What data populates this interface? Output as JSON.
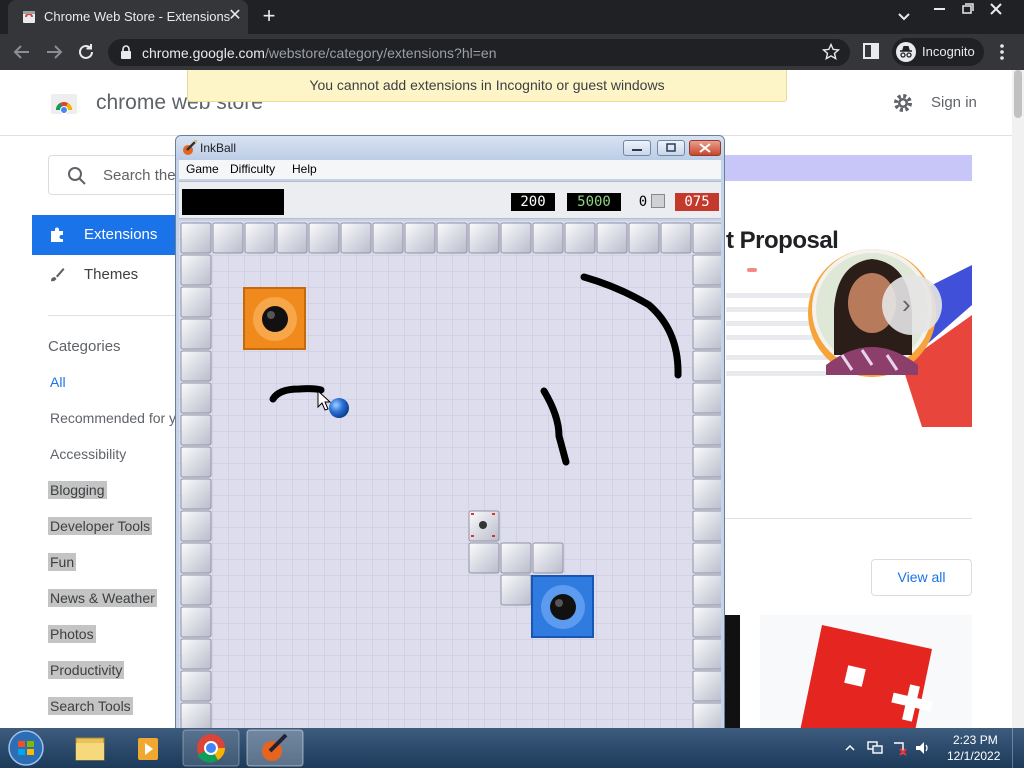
{
  "browser": {
    "tab_title": "Chrome Web Store - Extensions",
    "url_host": "chrome.google.com",
    "url_path": "/webstore/category/extensions?hl=en",
    "profile_label": "Incognito"
  },
  "page": {
    "store_title": "chrome web store",
    "sign_in": "Sign in",
    "toast": "You cannot add extensions in Incognito or guest windows",
    "search_placeholder": "Search the",
    "nav": {
      "extensions": "Extensions",
      "themes": "Themes"
    },
    "categories_title": "Categories",
    "categories": [
      {
        "label": "All",
        "state": "selected"
      },
      {
        "label": "Recommended for y",
        "state": "normal"
      },
      {
        "label": "Accessibility",
        "state": "normal"
      },
      {
        "label": "Blogging",
        "state": "highlighted"
      },
      {
        "label": "Developer Tools",
        "state": "highlighted"
      },
      {
        "label": "Fun",
        "state": "highlighted"
      },
      {
        "label": "News & Weather",
        "state": "highlighted"
      },
      {
        "label": "Photos",
        "state": "highlighted"
      },
      {
        "label": "Productivity",
        "state": "highlighted"
      },
      {
        "label": "Search Tools",
        "state": "highlighted"
      }
    ],
    "promo_title": "t Proposal",
    "view_all": "View all"
  },
  "inkball": {
    "title": "InkBall",
    "menu": [
      "Game",
      "Difficulty",
      "Help"
    ],
    "score": "200",
    "target_score": "5000",
    "balls_remaining": "0",
    "time": "075",
    "colors": {
      "orange_hole": "#f08a1c",
      "blue_hole": "#2f7be0",
      "ball": "#2a6fd6",
      "ink": "#000000"
    }
  },
  "taskbar": {
    "time": "2:23 PM",
    "date": "12/1/2022"
  },
  "colors": {
    "accent": "#1a73e8",
    "toast_bg": "#fdf5c8",
    "taskbar": "#1c3a5a"
  }
}
